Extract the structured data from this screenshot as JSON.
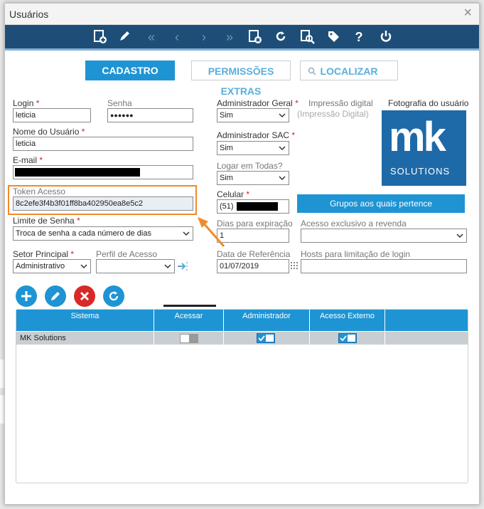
{
  "window": {
    "title": "Usuários"
  },
  "toolbar": {
    "icons": [
      "add-user-icon",
      "edit-icon",
      "first-icon",
      "previous-icon",
      "next-icon",
      "last-icon",
      "delete-icon",
      "refresh-icon",
      "search-icon",
      "tag-icon",
      "help-icon",
      "power-icon"
    ]
  },
  "tabs": {
    "cadastro": "CADASTRO",
    "permissoes": "PERMISSÕES EXTRAS",
    "localizar": "LOCALIZAR"
  },
  "form": {
    "login": {
      "label": "Login",
      "required": "*",
      "value": "leticia"
    },
    "senha": {
      "label": "Senha",
      "value": "●●●●●●"
    },
    "nome": {
      "label": "Nome do Usuário",
      "required": "*",
      "value": "leticia"
    },
    "email": {
      "label": "E-mail",
      "required": "*"
    },
    "token": {
      "label": "Token Acesso",
      "value": "8c2efe3f4b3f01ff8ba402950ea8e5c2"
    },
    "limite": {
      "label": "Limite de Senha",
      "required": "*",
      "value": "Troca de senha a cada número de dias"
    },
    "setor": {
      "label": "Setor Principal",
      "required": "*",
      "value": "Administrativo"
    },
    "perfil": {
      "label": "Perfil de Acesso",
      "value": ""
    },
    "admin_geral": {
      "label": "Administrador Geral",
      "required": "*",
      "value": "Sim"
    },
    "admin_sac": {
      "label": "Administrador SAC",
      "required": "*",
      "value": "Sim"
    },
    "logar_todas": {
      "label": "Logar em Todas?",
      "value": "Sim"
    },
    "celular": {
      "label": "Celular",
      "required": "*",
      "value": "(51)"
    },
    "dias_expiracao": {
      "label": "Dias para expiração",
      "value": "1"
    },
    "acesso_revenda": {
      "label": "Acesso exclusivo a revenda",
      "value": ""
    },
    "data_ref": {
      "label": "Data de Referência",
      "value": "01/07/2019"
    },
    "hosts": {
      "label": "Hosts para limitação de login",
      "value": ""
    },
    "impressao": {
      "label": "Impressão digital",
      "placeholder": "(Impressão Digital)"
    },
    "foto": {
      "label": "Fotografia do usuário"
    },
    "grupos_button": "Grupos aos quais pertence"
  },
  "logo": {
    "line1": "mk",
    "line2": "SOLUTIONS"
  },
  "table": {
    "columns": [
      "Sistema",
      "Acessar",
      "Administrador",
      "Acesso Externo"
    ],
    "rows": [
      {
        "sistema": "MK Solutions",
        "acessar": false,
        "administrador": true,
        "acesso_externo": true
      }
    ]
  },
  "colors": {
    "accent": "#1e94d4",
    "toolbar": "#1e4e78",
    "highlight": "#f08a2a",
    "required": "#d42020"
  }
}
